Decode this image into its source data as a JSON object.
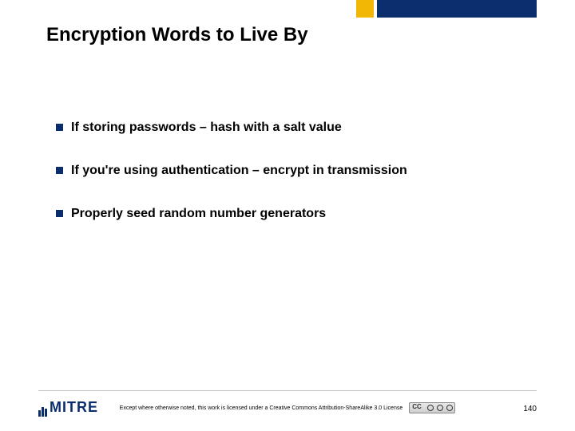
{
  "slide": {
    "title": "Encryption Words to Live By",
    "bullets": [
      "If storing passwords – hash with a salt value",
      "If you're using authentication – encrypt in transmission",
      "Properly seed random number generators"
    ]
  },
  "footer": {
    "logo_text": "MITRE",
    "license_text": "Except where otherwise noted, this work is licensed under a Creative Commons Attribution-ShareAlike 3.0 License",
    "page_number": "140"
  },
  "theme": {
    "accent_primary": "#0a2d6e",
    "accent_secondary": "#f2b705"
  }
}
